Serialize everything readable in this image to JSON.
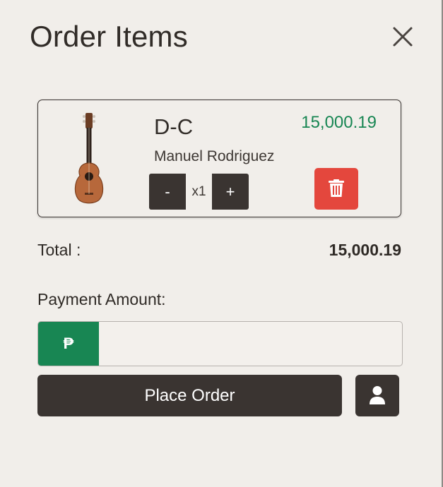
{
  "header": {
    "title": "Order Items",
    "close_icon": "close-icon"
  },
  "order": {
    "items": [
      {
        "name": "D-C",
        "brand": "Manuel Rodriguez",
        "price": "15,000.19",
        "quantity_label": "x1",
        "minus_label": "-",
        "plus_label": "+",
        "thumbnail_icon": "guitar-image",
        "delete_icon": "trash-icon"
      }
    ]
  },
  "summary": {
    "total_label": "Total :",
    "total_value": "15,000.19"
  },
  "payment": {
    "label": "Payment Amount:",
    "currency_symbol": "₱",
    "value": ""
  },
  "actions": {
    "place_order_label": "Place Order",
    "customer_icon": "user-icon"
  },
  "colors": {
    "background": "#f1eeea",
    "dark": "#3a3431",
    "accent_green": "#188653",
    "danger": "#e4473d"
  }
}
